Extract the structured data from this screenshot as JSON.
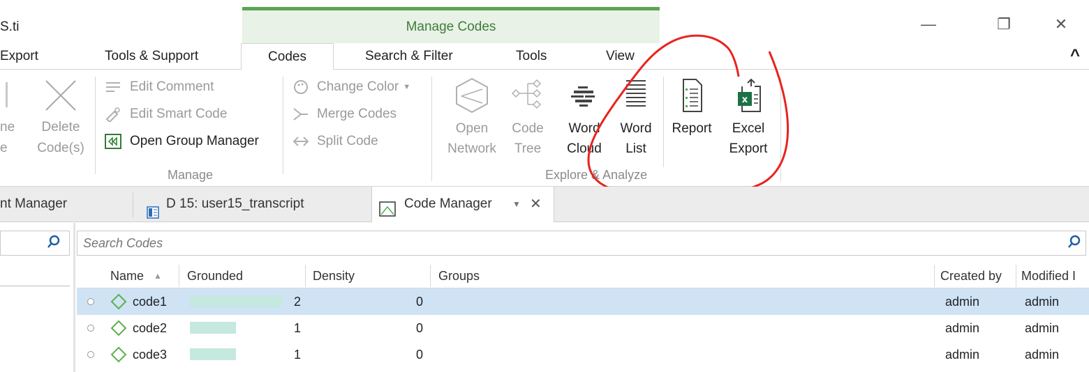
{
  "window": {
    "app_title": "S.ti",
    "context_tab_title": "Manage Codes",
    "controls": {
      "minimize": "—",
      "restore": "❐",
      "close": "✕"
    }
  },
  "ribbon_tabs": [
    "Export",
    "Tools & Support",
    "Codes",
    "Search & Filter",
    "Tools",
    "View"
  ],
  "collapse_glyph": "^",
  "ribbon": {
    "partial_left": {
      "line1": "ne",
      "line2": "e"
    },
    "delete_button": {
      "line1": "Delete",
      "line2": "Code(s)"
    },
    "manage_items": {
      "edit_comment": "Edit Comment",
      "edit_smart_code": "Edit Smart Code",
      "open_group_manager": "Open Group Manager"
    },
    "color_items": {
      "change_color": "Change Color",
      "merge_codes": "Merge Codes",
      "split_code": "Split Code"
    },
    "manage_label": "Manage",
    "explore_buttons": [
      {
        "line1": "Open",
        "line2": "Network"
      },
      {
        "line1": "Code",
        "line2": "Tree"
      },
      {
        "line1": "Word",
        "line2": "Cloud"
      },
      {
        "line1": "Word",
        "line2": "List"
      },
      {
        "line1": "Report",
        "line2": ""
      },
      {
        "line1": "Excel",
        "line2": "Export"
      }
    ],
    "explore_label": "Explore & Analyze"
  },
  "doc_tabs": {
    "first": "nt Manager",
    "second": "D 15: user15_transcript",
    "active": "Code Manager"
  },
  "search": {
    "placeholder": "Search Codes"
  },
  "columns": {
    "name": "Name",
    "grounded": "Grounded",
    "density": "Density",
    "groups": "Groups",
    "created_by": "Created by",
    "modified_by": "Modified I"
  },
  "codes": [
    {
      "name": "code1",
      "grounded": "2",
      "grounded_fraction": 1.0,
      "density": "0",
      "created_by": "admin",
      "modified_by": "admin",
      "selected": true
    },
    {
      "name": "code2",
      "grounded": "1",
      "grounded_fraction": 0.5,
      "density": "0",
      "created_by": "admin",
      "modified_by": "admin",
      "selected": false
    },
    {
      "name": "code3",
      "grounded": "1",
      "grounded_fraction": 0.5,
      "density": "0",
      "created_by": "admin",
      "modified_by": "admin",
      "selected": false
    }
  ],
  "colors": {
    "context_green": "#5aa552",
    "annotation_red": "#e8231f",
    "row_selected": "#cfe3f5",
    "grounded_bar": "#c5e8df"
  }
}
